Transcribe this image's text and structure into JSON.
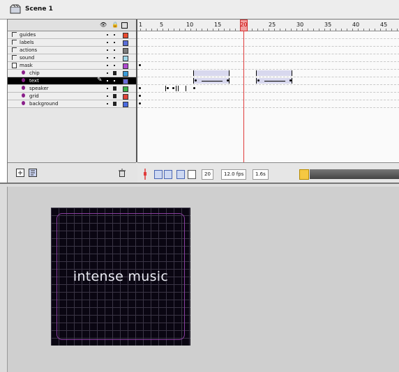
{
  "scene": {
    "label": "Scene 1"
  },
  "layers": [
    {
      "name": "guides",
      "type": "guide",
      "lock": false,
      "color": "#e94a2e",
      "selected": false
    },
    {
      "name": "labels",
      "type": "guide",
      "lock": false,
      "color": "#5a6ed8",
      "selected": false
    },
    {
      "name": "actions",
      "type": "guide",
      "lock": false,
      "color": "#7c7c7c",
      "selected": false
    },
    {
      "name": "sound",
      "type": "guide",
      "lock": false,
      "color": "#9fd6e8",
      "selected": false
    },
    {
      "name": "mask",
      "type": "mask",
      "lock": false,
      "color": "#b04ad0",
      "selected": false
    },
    {
      "name": "chip",
      "type": "masked",
      "lock": true,
      "color": "#3a9ad8",
      "selected": false
    },
    {
      "name": "text",
      "type": "masked",
      "lock": false,
      "color": "#6a6ad8",
      "selected": true
    },
    {
      "name": "speaker",
      "type": "masked",
      "lock": true,
      "color": "#3bb04a",
      "selected": false
    },
    {
      "name": "grid",
      "type": "masked",
      "lock": true,
      "color": "#e0443a",
      "selected": false
    },
    {
      "name": "background",
      "type": "masked",
      "lock": true,
      "color": "#4a6ae0",
      "selected": false
    }
  ],
  "ruler": {
    "ticks": [
      "1",
      "5",
      "10",
      "15",
      "20",
      "25",
      "30",
      "35",
      "40",
      "45"
    ],
    "current": "20"
  },
  "status": {
    "frame": "20",
    "fps": "12.0 fps",
    "time": "1.6s"
  },
  "stage": {
    "text": "intense music"
  },
  "colors": {
    "playhead": "#e03b3b",
    "selection": "#000000",
    "scroll_thumb": "#f5c842"
  }
}
